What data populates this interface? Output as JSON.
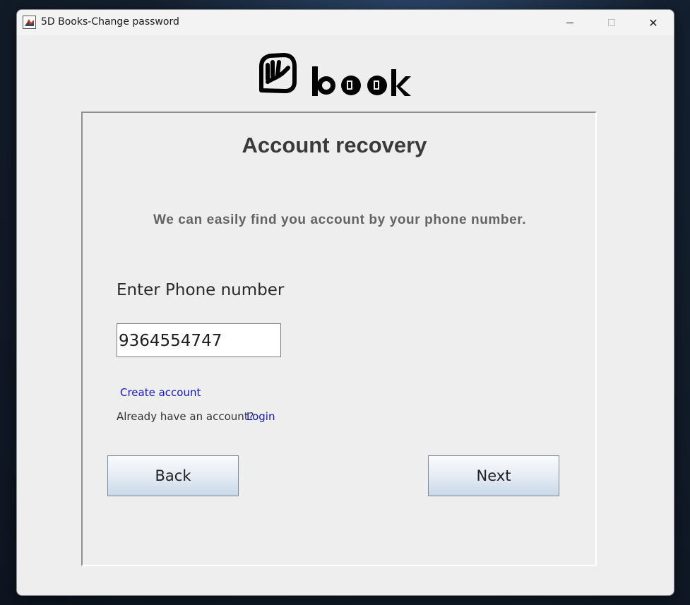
{
  "window": {
    "title": "5D Books-Change password",
    "minimize_icon": "minimize-icon",
    "maximize_icon": "maximize-icon",
    "close_icon": "close-icon",
    "close_glyph": "✕"
  },
  "logo": {
    "icon": "hand-logo-icon"
  },
  "recovery": {
    "heading": "Account recovery",
    "subtitle": "We can easily find you account by your phone number.",
    "phone_label": "Enter Phone number",
    "phone_value": "9364554747",
    "create_account": "Create account",
    "already_text": "Already have an account?",
    "login_link": "Login",
    "back_button": "Back",
    "next_button": "Next"
  },
  "colors": {
    "link": "#1515c9",
    "button_gradient_bottom": "#c9d8e8",
    "panel_bg": "#eeeeee"
  }
}
